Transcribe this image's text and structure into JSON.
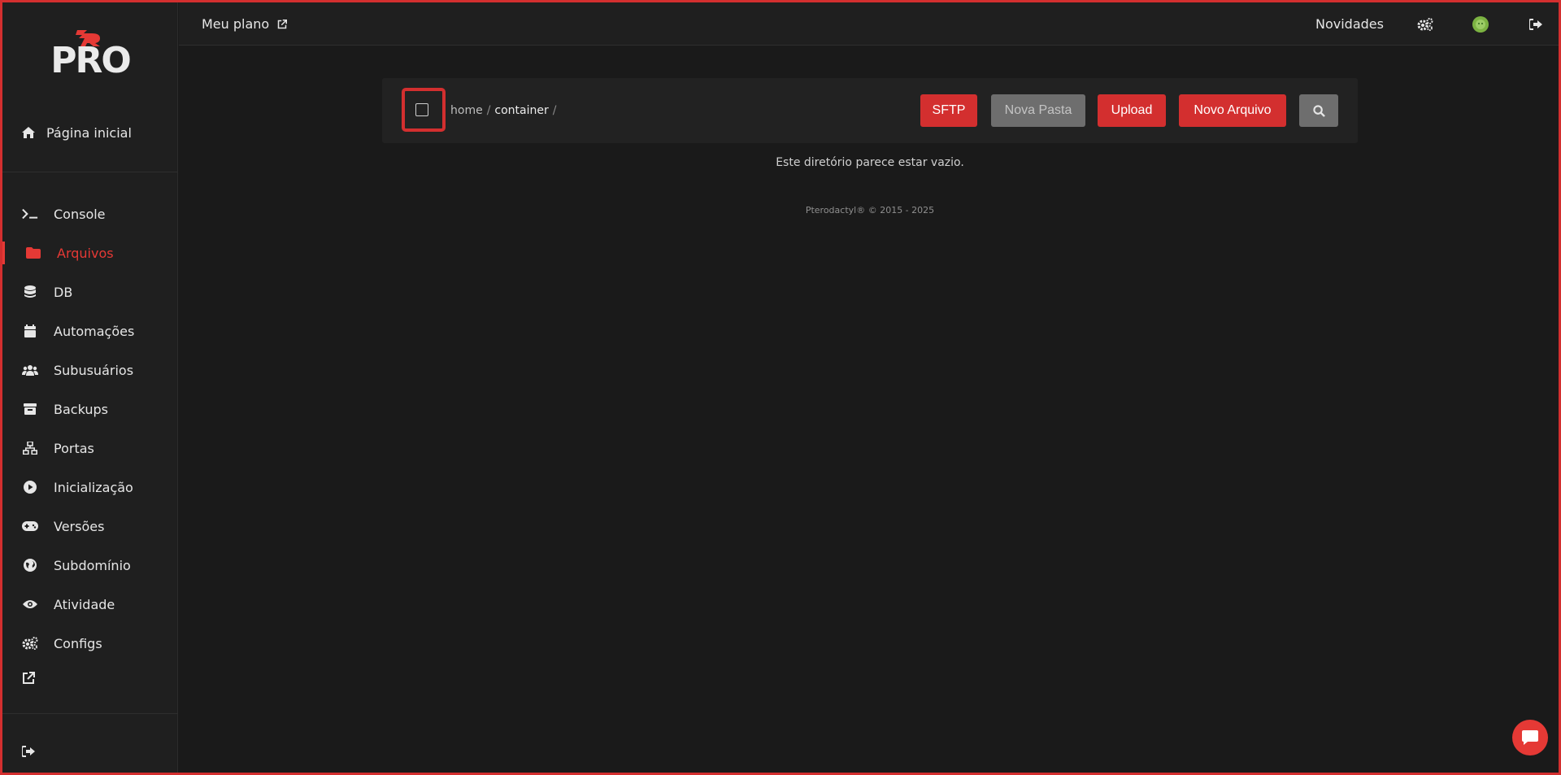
{
  "logo": {
    "text": "PRO"
  },
  "sidebar": {
    "home_label": "Página inicial",
    "items": [
      {
        "label": "Console",
        "icon": "terminal-icon"
      },
      {
        "label": "Arquivos",
        "icon": "folder-icon",
        "active": true
      },
      {
        "label": "DB",
        "icon": "database-icon"
      },
      {
        "label": "Automações",
        "icon": "calendar-icon"
      },
      {
        "label": "Subusuários",
        "icon": "users-icon"
      },
      {
        "label": "Backups",
        "icon": "archive-icon"
      },
      {
        "label": "Portas",
        "icon": "network-icon"
      },
      {
        "label": "Inicialização",
        "icon": "play-icon"
      },
      {
        "label": "Versões",
        "icon": "gamepad-icon"
      },
      {
        "label": "Subdomínio",
        "icon": "globe-icon"
      },
      {
        "label": "Atividade",
        "icon": "eye-icon"
      },
      {
        "label": "Configs",
        "icon": "gears-icon"
      }
    ]
  },
  "topbar": {
    "plan_label": "Meu plano",
    "news_label": "Novidades"
  },
  "files": {
    "breadcrumb": [
      "home",
      "container"
    ],
    "sep": "/",
    "buttons": {
      "sftp": "SFTP",
      "new_folder": "Nova Pasta",
      "upload": "Upload",
      "new_file": "Novo Arquivo"
    },
    "empty_message": "Este diretório parece estar vazio."
  },
  "footer": {
    "text": "Pterodactyl® © 2015 - 2025"
  },
  "colors": {
    "accent": "#d32f2f",
    "background": "#1a1a1a",
    "panel": "#222222",
    "disabled": "#6e6e6e"
  }
}
